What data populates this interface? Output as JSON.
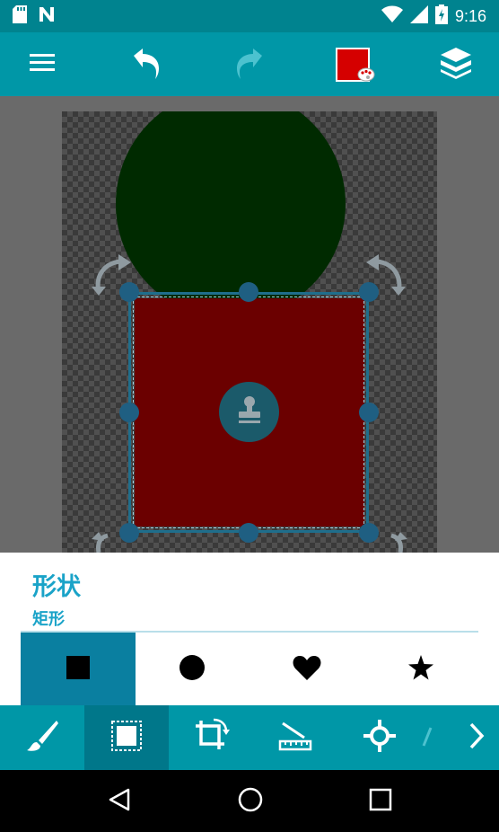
{
  "status_bar": {
    "time": "9:16",
    "icons": [
      "sd-card-icon",
      "notification-n-icon",
      "wifi-icon",
      "signal-icon",
      "battery-charging-icon"
    ]
  },
  "toolbar": {
    "menu_icon": "menu-icon",
    "undo_icon": "undo-icon",
    "redo_icon": "redo-icon",
    "current_color": "#d50000",
    "layers_icon": "layers-icon"
  },
  "canvas": {
    "circle_color": "#002a00",
    "rect_color": "#6b0000",
    "selection_color": "#1f6e8c"
  },
  "shape_panel": {
    "title": "形状",
    "selected_shape_name": "矩形",
    "shapes": [
      {
        "name": "square-shape-icon",
        "selected": true
      },
      {
        "name": "circle-shape-icon",
        "selected": false
      },
      {
        "name": "heart-shape-icon",
        "selected": false
      },
      {
        "name": "star-shape-icon",
        "selected": false
      }
    ]
  },
  "tools": [
    {
      "name": "brush-icon",
      "active": false
    },
    {
      "name": "shape-select-icon",
      "active": true
    },
    {
      "name": "rotate-crop-icon",
      "active": false
    },
    {
      "name": "ruler-icon",
      "active": false
    },
    {
      "name": "crosshair-icon",
      "active": false
    }
  ],
  "colors": {
    "accent": "#0097a7",
    "status": "#00838f",
    "panel_text": "#1aa3c8"
  }
}
